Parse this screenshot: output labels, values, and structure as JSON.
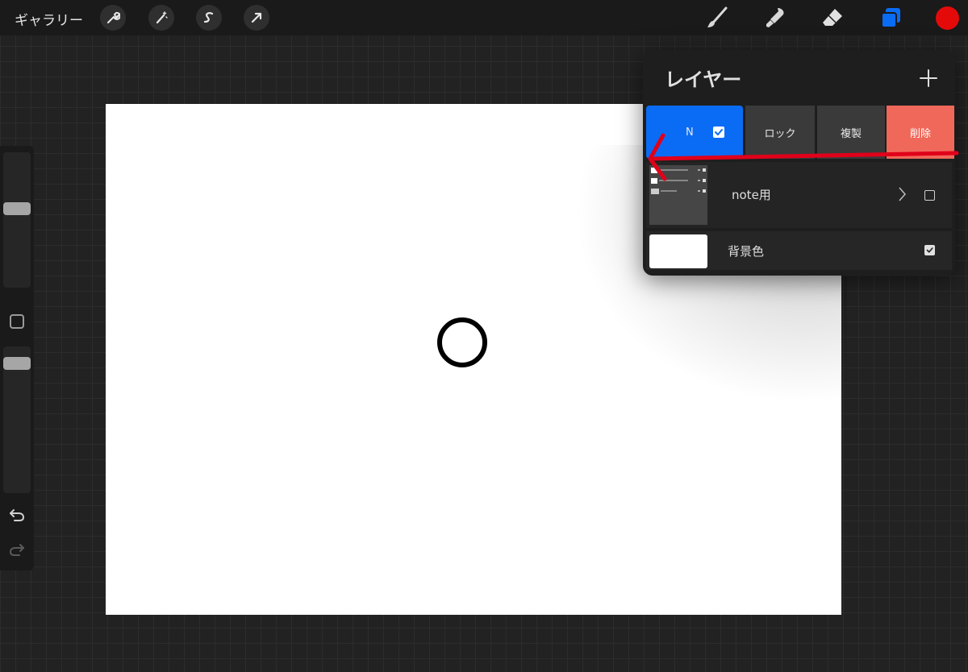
{
  "topbar": {
    "gallery_label": "ギャラリー",
    "left_tools": [
      "wrench-icon",
      "magic-wand-icon",
      "selection-s-icon",
      "transform-arrow-icon"
    ],
    "right_tools": [
      "brush-icon",
      "smudge-icon",
      "eraser-icon",
      "layers-icon"
    ],
    "current_color": "#e50a0a"
  },
  "layers_panel": {
    "title": "レイヤー",
    "actions": {
      "blend_mode": "N",
      "lock": "ロック",
      "duplicate": "複製",
      "delete": "削除"
    },
    "layers": [
      {
        "name": "note用",
        "visible": false,
        "is_group": true
      },
      {
        "name": "背景色",
        "visible": true,
        "is_group": false
      }
    ]
  },
  "colors": {
    "accent_blue": "#0a6cf5",
    "delete_red": "#f0685a",
    "annotation_arrow": "#e0001a"
  }
}
